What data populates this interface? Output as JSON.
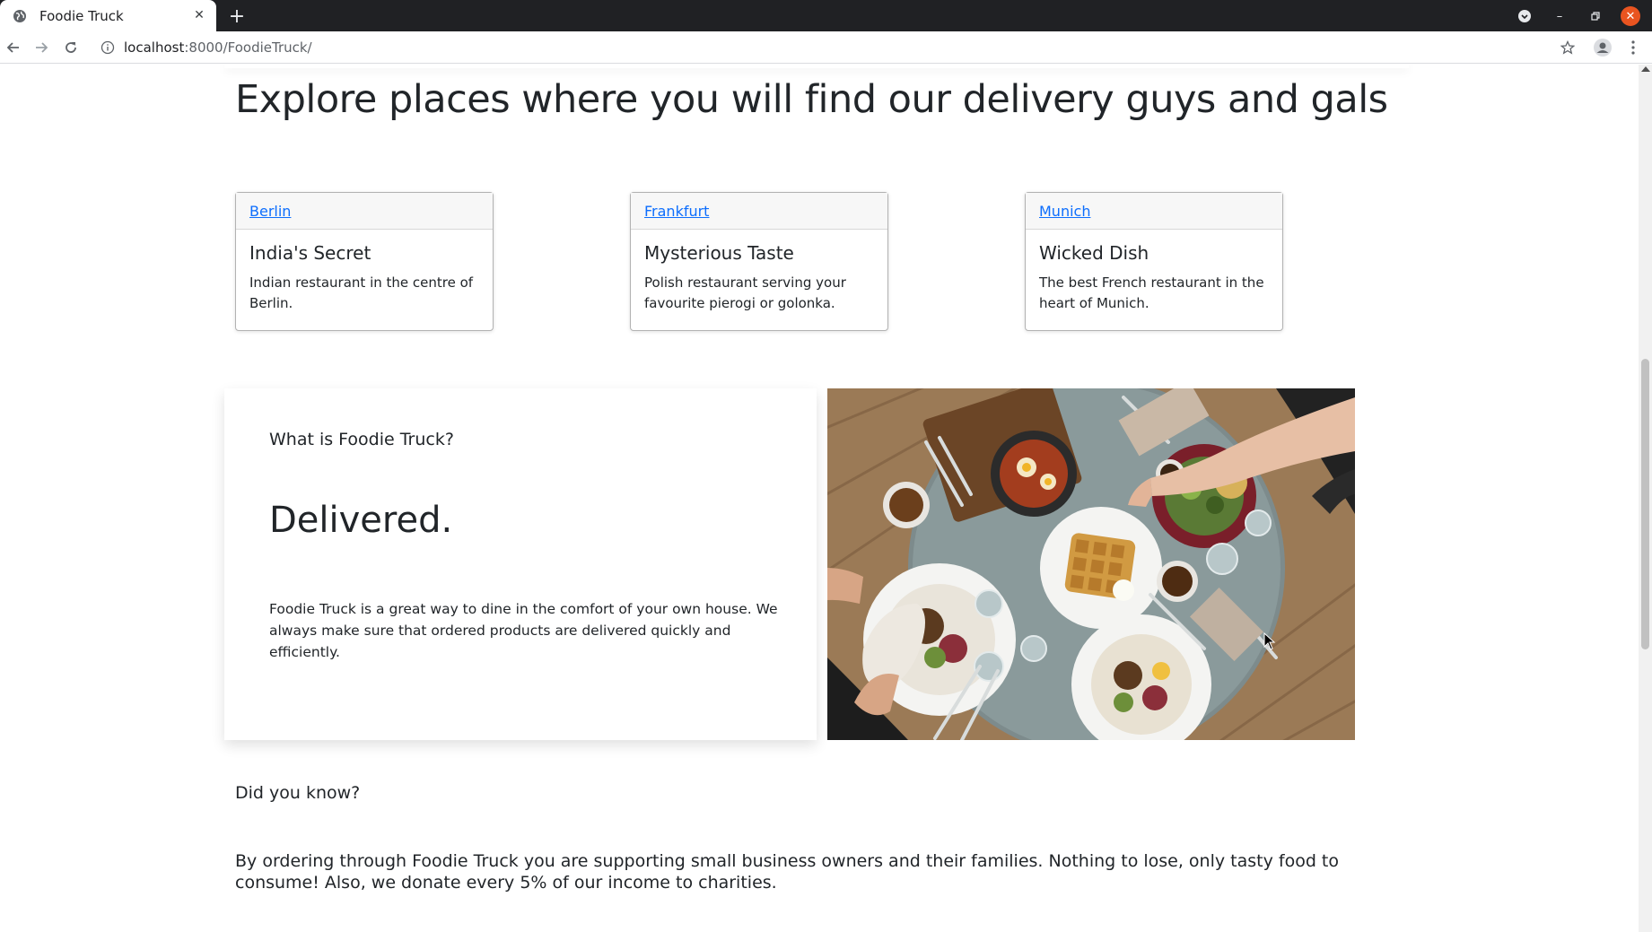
{
  "browser": {
    "tab_title": "Foodie Truck",
    "url_host": "localhost",
    "url_path": ":8000/FoodieTruck/"
  },
  "page": {
    "section_title": "Explore places where you will find our delivery guys and gals",
    "cards": [
      {
        "city": "Berlin",
        "name": "India's Secret",
        "description": "Indian restaurant in the centre of Berlin."
      },
      {
        "city": "Frankfurt",
        "name": "Mysterious Taste",
        "description": "Polish restaurant serving your favourite pierogi or golonka."
      },
      {
        "city": "Munich",
        "name": "Wicked Dish",
        "description": "The best French restaurant in the heart of Munich."
      }
    ],
    "about": {
      "label": "What is Foodie Truck?",
      "heading": "Delivered.",
      "text": "Foodie Truck is a great way to dine in the comfort of your own house. We always make sure that ordered products are delivered quickly and efficiently."
    },
    "did_you_know": {
      "label": "Did you know?",
      "text": "By ordering through Foodie Truck you are supporting small business owners and their families. Nothing to lose, only tasty food to consume! Also, we donate every 5% of our income to charities."
    }
  },
  "colors": {
    "link": "#0d6efd",
    "tabbar": "#202124",
    "close_button": "#e95420"
  }
}
